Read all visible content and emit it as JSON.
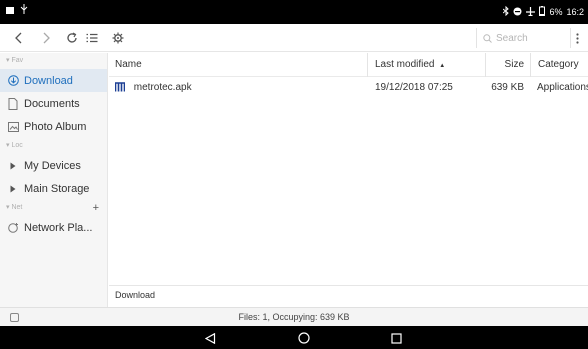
{
  "statusbar": {
    "time": "16:2",
    "battery": "6%"
  },
  "toolbar": {
    "search_placeholder": "Search"
  },
  "sidebar": {
    "sections": [
      {
        "header": "Fav",
        "items": [
          {
            "label": "Download",
            "icon": "download-circle-icon",
            "active": true
          },
          {
            "label": "Documents",
            "icon": "document-icon"
          },
          {
            "label": "Photo Album",
            "icon": "photo-icon"
          }
        ]
      },
      {
        "header": "Loc",
        "items": [
          {
            "label": "My Devices",
            "icon": "triangle-right-icon"
          },
          {
            "label": "Main Storage",
            "icon": "triangle-right-icon"
          }
        ]
      },
      {
        "header": "Net",
        "plus": "+",
        "items": [
          {
            "label": "Network Pla...",
            "icon": "network-icon"
          }
        ]
      }
    ]
  },
  "table": {
    "columns": {
      "name": "Name",
      "modified": "Last modified",
      "sort_indicator": "▲",
      "size": "Size",
      "category": "Category"
    },
    "rows": [
      {
        "name": "metrotec.apk",
        "modified": "19/12/2018 07:25",
        "size": "639 KB",
        "category": "Applications"
      }
    ]
  },
  "pathbar": {
    "path": "Download"
  },
  "infobar": {
    "text": "Files: 1, Occupying: 639 KB"
  },
  "colors": {
    "accent": "#1f6fbd",
    "apk_brand": "#1c3f94",
    "active_bg": "#e1e9f2"
  }
}
